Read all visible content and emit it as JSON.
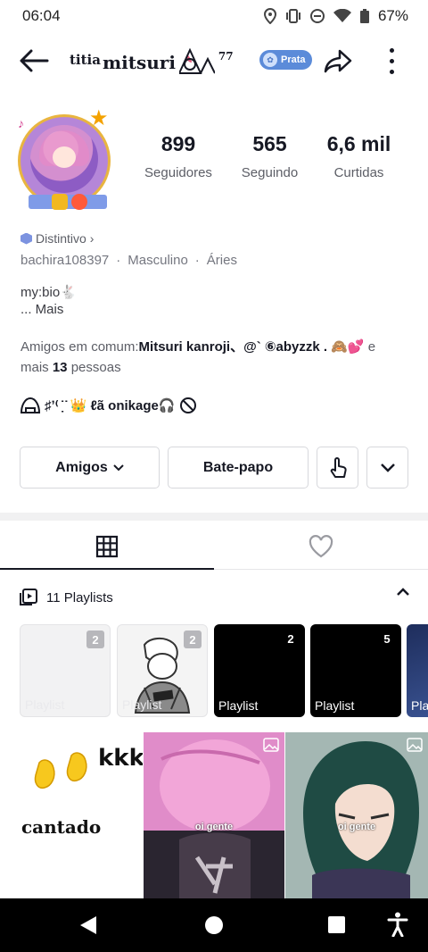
{
  "status_bar": {
    "time": "06:04",
    "battery": "67%"
  },
  "header": {
    "username_prefix": "titia",
    "username_main": "mitsuri",
    "username_suffix": "77",
    "badge_label": "Prata"
  },
  "stats": [
    {
      "value": "899",
      "label": "Seguidores"
    },
    {
      "value": "565",
      "label": "Seguindo"
    },
    {
      "value": "6,6 mil",
      "label": "Curtidas"
    }
  ],
  "profile": {
    "distintivo": "Distintivo",
    "handle": "bachira108397",
    "gender": "Masculino",
    "zodiac": "Áries",
    "separator": "·",
    "bio_line1": "my:bio🐇",
    "bio_more": "...  Mais",
    "mutual_prefix": "Amigos em comum:",
    "mutual_names": "Mitsuri kanroji、@` ⑥abyzzk .",
    "mutual_emoji": "🙈💕",
    "mutual_and": " e mais ",
    "mutual_count": "13",
    "mutual_people": " pessoas",
    "signature_text": "♯ʼ⁽ ̣̇ ̇ 👑 ℓã onikage🎧"
  },
  "actions": {
    "friends_label": "Amigos",
    "chat_label": "Bate-papo"
  },
  "playlists": {
    "header": "11 Playlists",
    "items": [
      {
        "label": "Playlist",
        "count": "2",
        "bg": "#f2f2f3"
      },
      {
        "label": "Playlist",
        "count": "2",
        "bg": "#ececec"
      },
      {
        "label": "Playlist",
        "count": "2",
        "bg": "#000000"
      },
      {
        "label": "Playlist",
        "count": "5",
        "bg": "#000000"
      },
      {
        "label": "Pla",
        "count": "",
        "bg": "#2a3b6e"
      }
    ]
  },
  "grid": {
    "first_text_top": "kkk",
    "first_text_bottom": "cantado",
    "caption_2": "oi gente",
    "caption_3": "oi gente"
  },
  "colors": {
    "accent_badge": "#5b8bd9",
    "text_primary": "#161823",
    "text_secondary": "#5c5e66"
  }
}
